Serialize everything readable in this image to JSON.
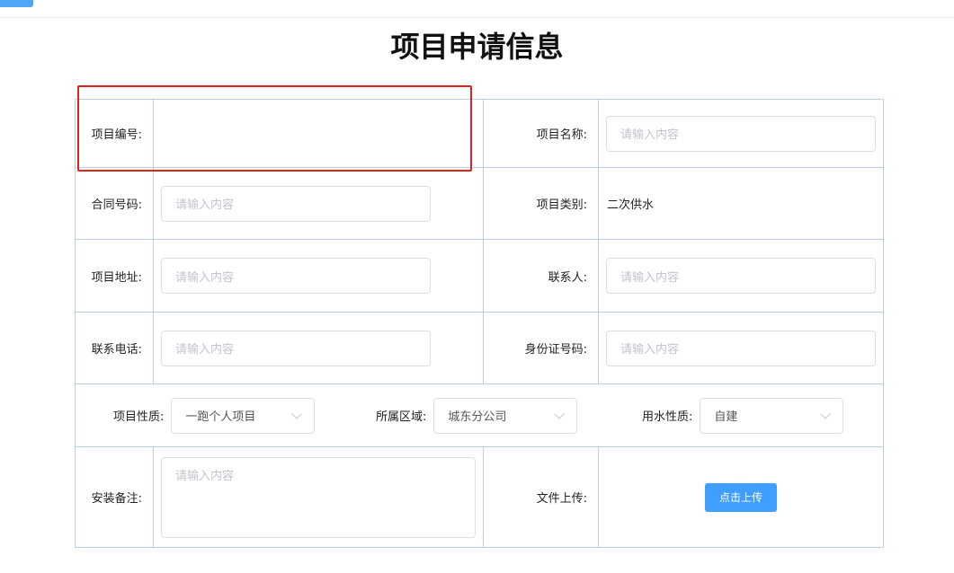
{
  "page": {
    "title": "项目申请信息"
  },
  "form": {
    "project_no": {
      "label": "项目编号:",
      "value": ""
    },
    "project_name": {
      "label": "项目名称:",
      "placeholder": "请输入内容"
    },
    "contract_no": {
      "label": "合同号码:",
      "placeholder": "请输入内容"
    },
    "project_type": {
      "label": "项目类别:",
      "value": "二次供水"
    },
    "project_address": {
      "label": "项目地址:",
      "placeholder": "请输入内容"
    },
    "contact": {
      "label": "联系人:",
      "placeholder": "请输入内容"
    },
    "phone": {
      "label": "联系电话:",
      "placeholder": "请输入内容"
    },
    "id_no": {
      "label": "身份证号码:",
      "placeholder": "请输入内容"
    },
    "project_nature": {
      "label": "项目性质:",
      "value": "一跑个人项目"
    },
    "region": {
      "label": "所属区域:",
      "value": "城东分公司"
    },
    "water_nature": {
      "label": "用水性质:",
      "value": "自建"
    },
    "install_note": {
      "label": "安装备注:",
      "placeholder": "请输入内容"
    },
    "file_upload": {
      "label": "文件上传:",
      "button_label": "点击上传"
    }
  },
  "colors": {
    "border": "#b8cfe6",
    "primary": "#409eff",
    "highlight": "#e2231a"
  }
}
